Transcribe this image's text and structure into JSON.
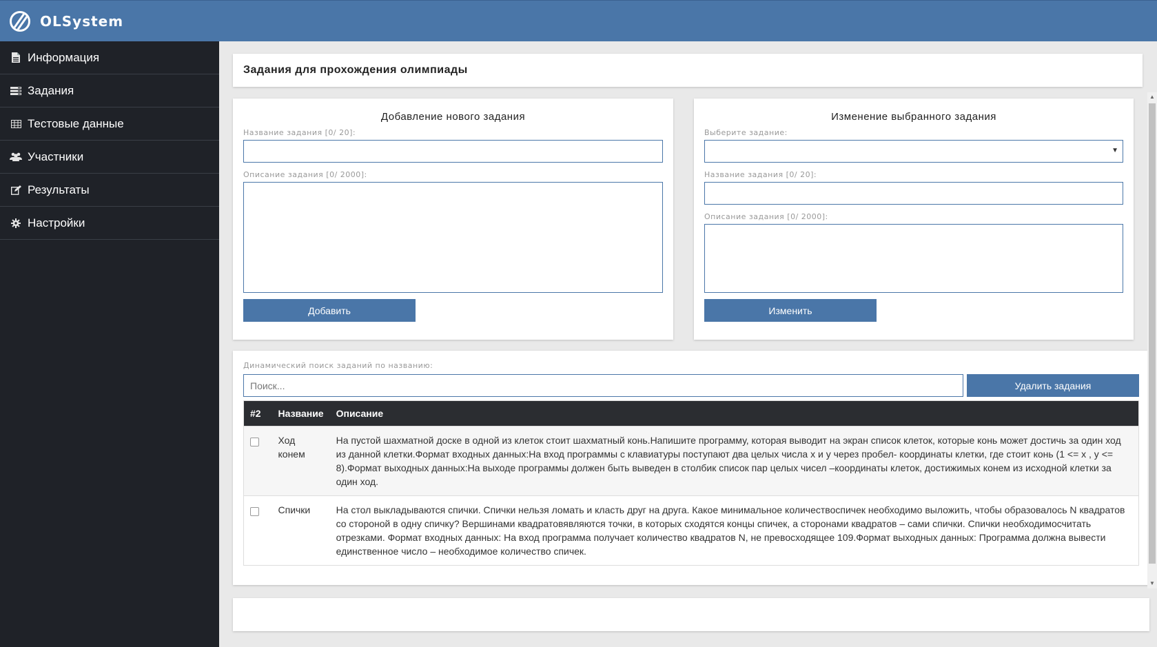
{
  "app": {
    "brand": "OLSystem"
  },
  "sidebar": {
    "items": [
      {
        "label": "Информация",
        "icon": "file-icon"
      },
      {
        "label": "Задания",
        "icon": "tasks-icon"
      },
      {
        "label": "Тестовые данные",
        "icon": "table-icon"
      },
      {
        "label": "Участники",
        "icon": "users-icon"
      },
      {
        "label": "Результаты",
        "icon": "edit-icon"
      },
      {
        "label": "Настройки",
        "icon": "gear-icon"
      }
    ]
  },
  "page": {
    "title": "Задания для прохождения олимпиады"
  },
  "add_form": {
    "heading": "Добавление нового задания",
    "name_label": "Название задания [0/ 20]:",
    "name_value": "",
    "desc_label": "Описание задания [0/ 2000]:",
    "desc_value": "",
    "submit_label": "Добавить"
  },
  "edit_form": {
    "heading": "Изменение выбранного задания",
    "select_label": "Выберите задание:",
    "select_value": "",
    "name_label": "Название задания [0/ 20]:",
    "name_value": "",
    "desc_label": "Описание задания [0/ 2000]:",
    "desc_value": "",
    "submit_label": "Изменить"
  },
  "search": {
    "label": "Динамический поиск заданий по названию:",
    "placeholder": "Поиск...",
    "value": "",
    "delete_label": "Удалить задания"
  },
  "table": {
    "columns": [
      "#2",
      "Название",
      "Описание"
    ],
    "rows": [
      {
        "checked": false,
        "name": "Ход конем",
        "description": "На пустой шахматной доске в одной из клеток стоит шахматный конь.Напишите программу, которая выводит на экран список клеток, которые конь может достичь за один ход из данной клетки.Формат входных данных:На вход программы с клавиатуры поступают два целых числа x и y через пробел- координаты клетки, где стоит конь (1 <= x , y <= 8).Формат выходных данных:На выходе программы должен быть выведен в столбик список пар целых чисел –координаты клеток, достижимых конем из исходной клетки за один ход."
      },
      {
        "checked": false,
        "name": "Спички",
        "description": "На стол выкладываются спички. Спички нельзя ломать и класть друг на друга. Какое минимальное количествоспичек необходимо выложить, чтобы образовалось N квадратов со стороной в одну спичку? Вершинами квадратовявляются точки, в которых сходятся концы спичек, а сторонами квадратов – сами спички. Спички необходимосчитать отрезками. Формат входных данных: На вход программа получает количество квадратов N, не превосходящее 109.Формат выходных данных: Программа должна вывести единственное число – необходимое количество спичек."
      }
    ]
  },
  "colors": {
    "accent": "#4a76a8",
    "sidebar": "#1f2228",
    "table_header": "#2b2d31"
  }
}
